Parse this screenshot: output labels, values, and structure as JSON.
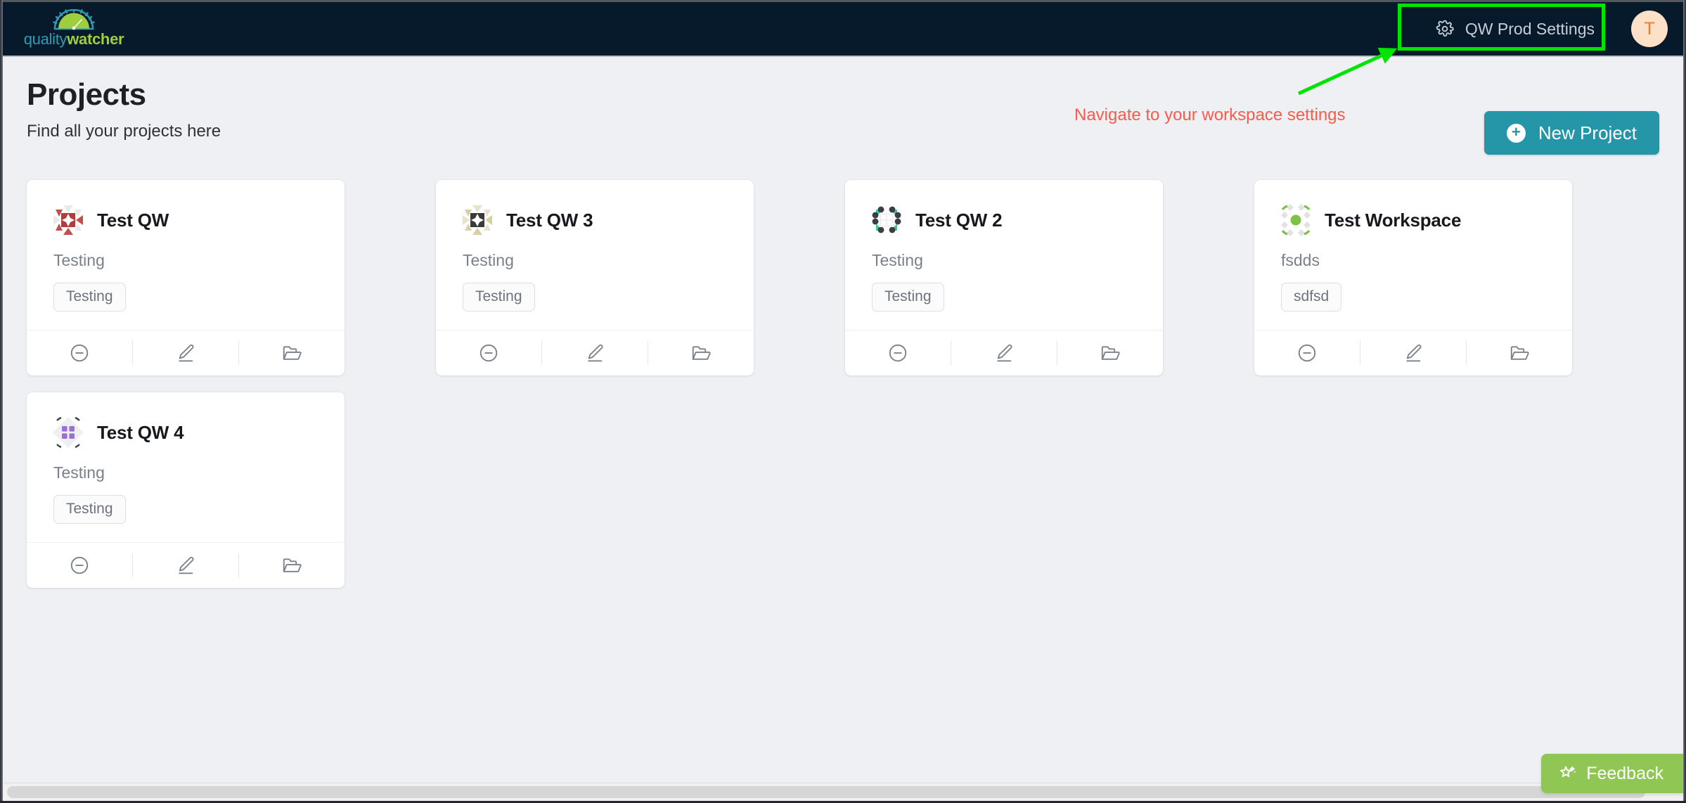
{
  "brand": {
    "name_part1": "quality",
    "name_part2": "watcher",
    "accent_blue": "#2e9bb3",
    "accent_green": "#9ecd3d"
  },
  "navbar": {
    "background": "#061a2b",
    "settings_label": "QW Prod Settings",
    "settings_icon": "gear-icon",
    "avatar_initial": "T",
    "avatar_bg": "#fce0c8",
    "avatar_fg": "#f2782a"
  },
  "annotation": {
    "caption": "Navigate to your workspace settings",
    "caption_color": "#fc5a4b",
    "highlight_color": "#00e400",
    "arrow_color": "#00e400"
  },
  "header": {
    "title": "Projects",
    "subtitle": "Find all your projects here"
  },
  "actions": {
    "new_project_label": "New Project",
    "new_project_icon": "plus-circle-icon",
    "new_project_color": "#2596a8"
  },
  "card_actions": {
    "archive_icon": "minus-circle-icon",
    "edit_icon": "pencil-icon",
    "open_icon": "folder-open-icon"
  },
  "projects": [
    {
      "name": "Test QW",
      "description": "Testing",
      "tag": "Testing",
      "avatar_style": "red-sparkle",
      "avatar_color": "#b33b3b"
    },
    {
      "name": "Test QW 3",
      "description": "Testing",
      "tag": "Testing",
      "avatar_style": "khaki-sparkle",
      "avatar_color": "#d9cfa3"
    },
    {
      "name": "Test QW 2",
      "description": "Testing",
      "tag": "Testing",
      "avatar_style": "dots-ring",
      "avatar_color": "#3ec79a"
    },
    {
      "name": "Test Workspace",
      "description": "fsdds",
      "tag": "sdfsd",
      "avatar_style": "green-dot",
      "avatar_color": "#7dc242"
    },
    {
      "name": "Test QW 4",
      "description": "Testing",
      "tag": "Testing",
      "avatar_style": "purple-grid",
      "avatar_color": "#9b6fd4"
    }
  ],
  "feedback": {
    "label": "Feedback",
    "icon": "star-sparkle-icon",
    "color": "#8fc654"
  }
}
